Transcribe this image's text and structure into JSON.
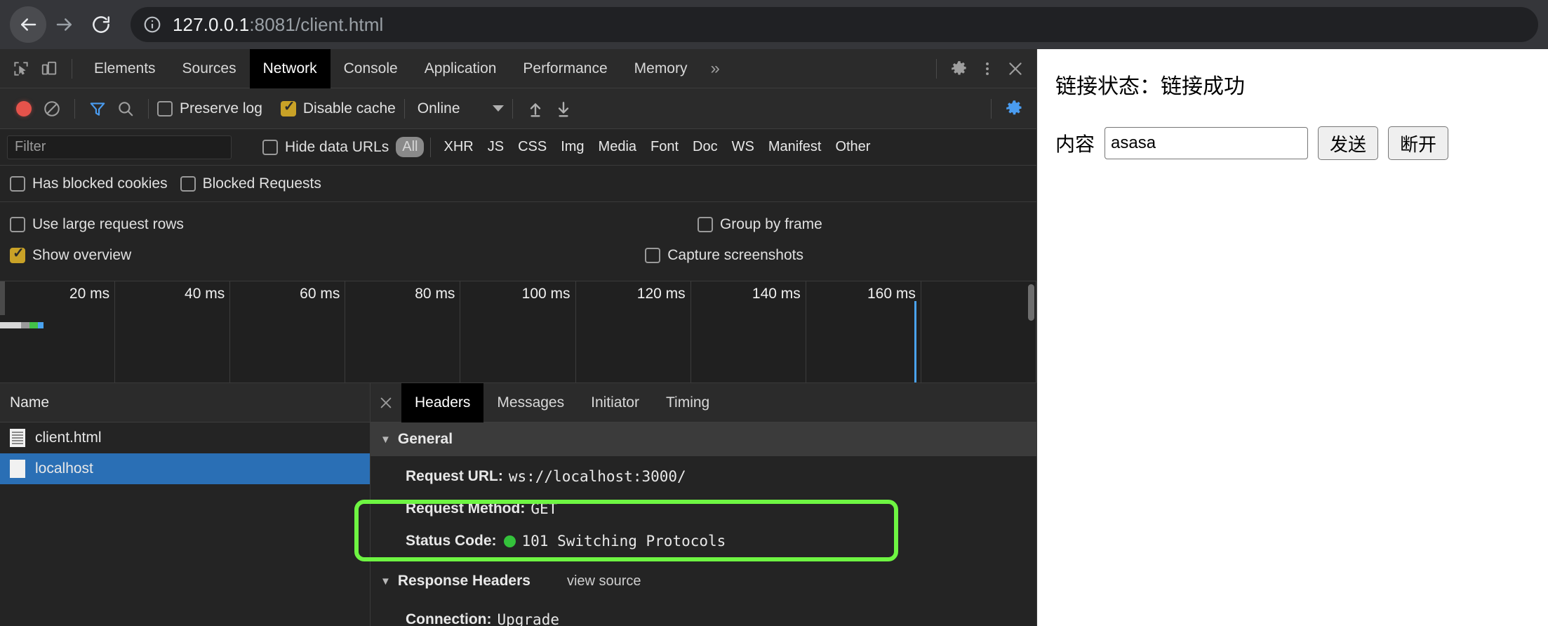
{
  "browser": {
    "back_icon": "arrow-left-icon",
    "forward_icon": "arrow-right-icon",
    "reload_icon": "reload-icon",
    "info_icon": "info-icon",
    "url_host": "127.0.0.1",
    "url_rest": ":8081/client.html"
  },
  "devtools": {
    "inspect_icon": "inspect-element-icon",
    "device_icon": "device-toolbar-icon",
    "tabs": [
      {
        "label": "Elements",
        "active": false
      },
      {
        "label": "Sources",
        "active": false
      },
      {
        "label": "Network",
        "active": true
      },
      {
        "label": "Console",
        "active": false
      },
      {
        "label": "Application",
        "active": false
      },
      {
        "label": "Performance",
        "active": false
      },
      {
        "label": "Memory",
        "active": false
      }
    ],
    "more_tabs_icon": "chevron-double-right-icon",
    "settings_icon": "gear-icon",
    "menu_icon": "kebab-menu-icon",
    "close_icon": "close-icon",
    "netbar": {
      "record_icon": "record-button-icon",
      "clear_icon": "clear-icon",
      "filter_icon": "filter-funnel-icon",
      "search_icon": "search-icon",
      "preserve_log_label": "Preserve log",
      "preserve_log_checked": false,
      "disable_cache_label": "Disable cache",
      "disable_cache_checked": true,
      "throttle_value": "Online",
      "throttle_arrow_icon": "chevron-down-icon",
      "import_icon": "import-har-icon",
      "export_icon": "export-har-icon",
      "network_settings_icon": "gear-icon"
    },
    "filterbar": {
      "filter_placeholder": "Filter",
      "filter_value": "",
      "hide_data_urls_label": "Hide data URLs",
      "hide_data_urls_checked": false,
      "types": [
        "All",
        "XHR",
        "JS",
        "CSS",
        "Img",
        "Media",
        "Font",
        "Doc",
        "WS",
        "Manifest",
        "Other"
      ],
      "active_type": "All"
    },
    "blocked_row": [
      {
        "label": "Has blocked cookies",
        "checked": false
      },
      {
        "label": "Blocked Requests",
        "checked": false
      }
    ],
    "settings_rows": [
      {
        "left": {
          "label": "Use large request rows",
          "checked": false
        },
        "right": {
          "label": "Group by frame",
          "checked": false
        }
      },
      {
        "left": {
          "label": "Show overview",
          "checked": true
        },
        "right": {
          "label": "Capture screenshots",
          "checked": false
        }
      }
    ],
    "overview": {
      "ticks": [
        "20 ms",
        "40 ms",
        "60 ms",
        "80 ms",
        "100 ms",
        "120 ms",
        "140 ms",
        "160 ms"
      ],
      "dom_content_loaded_color": "#4aa3f0",
      "bar_segments": [
        {
          "color": "#d8d8d8",
          "width": 30
        },
        {
          "color": "#9a9a9a",
          "width": 12
        },
        {
          "color": "#43c148",
          "width": 12
        },
        {
          "color": "#4aa3f0",
          "width": 8
        }
      ]
    },
    "requests": {
      "column_header": "Name",
      "rows": [
        {
          "name": "client.html",
          "icon": "document-icon",
          "selected": false
        },
        {
          "name": "localhost",
          "icon": "websocket-icon",
          "selected": true
        }
      ]
    },
    "detail": {
      "close_icon": "close-icon",
      "tabs": [
        {
          "label": "Headers",
          "active": true
        },
        {
          "label": "Messages",
          "active": false
        },
        {
          "label": "Initiator",
          "active": false
        },
        {
          "label": "Timing",
          "active": false
        }
      ],
      "general": {
        "title": "General",
        "arrow_icon": "triangle-down-icon",
        "items": [
          {
            "key": "Request URL:",
            "value": "ws://localhost:3000/",
            "dot": false
          },
          {
            "key": "Request Method:",
            "value": "GET",
            "dot": false
          },
          {
            "key": "Status Code:",
            "value": "101 Switching Protocols",
            "dot": true
          }
        ]
      },
      "response_headers": {
        "title": "Response Headers",
        "arrow_icon": "triangle-down-icon",
        "view_source": "view source",
        "items": [
          {
            "key": "Connection:",
            "value": "Upgrade",
            "dot": false
          }
        ]
      }
    },
    "annotation": {
      "color": "#6ef542",
      "shape": "rounded-rectangle-highlight"
    }
  },
  "page": {
    "status_line": "链接状态：链接成功",
    "content_label": "内容",
    "content_value": "asasa",
    "content_placeholder": "",
    "send_button": "发送",
    "disconnect_button": "断开"
  }
}
